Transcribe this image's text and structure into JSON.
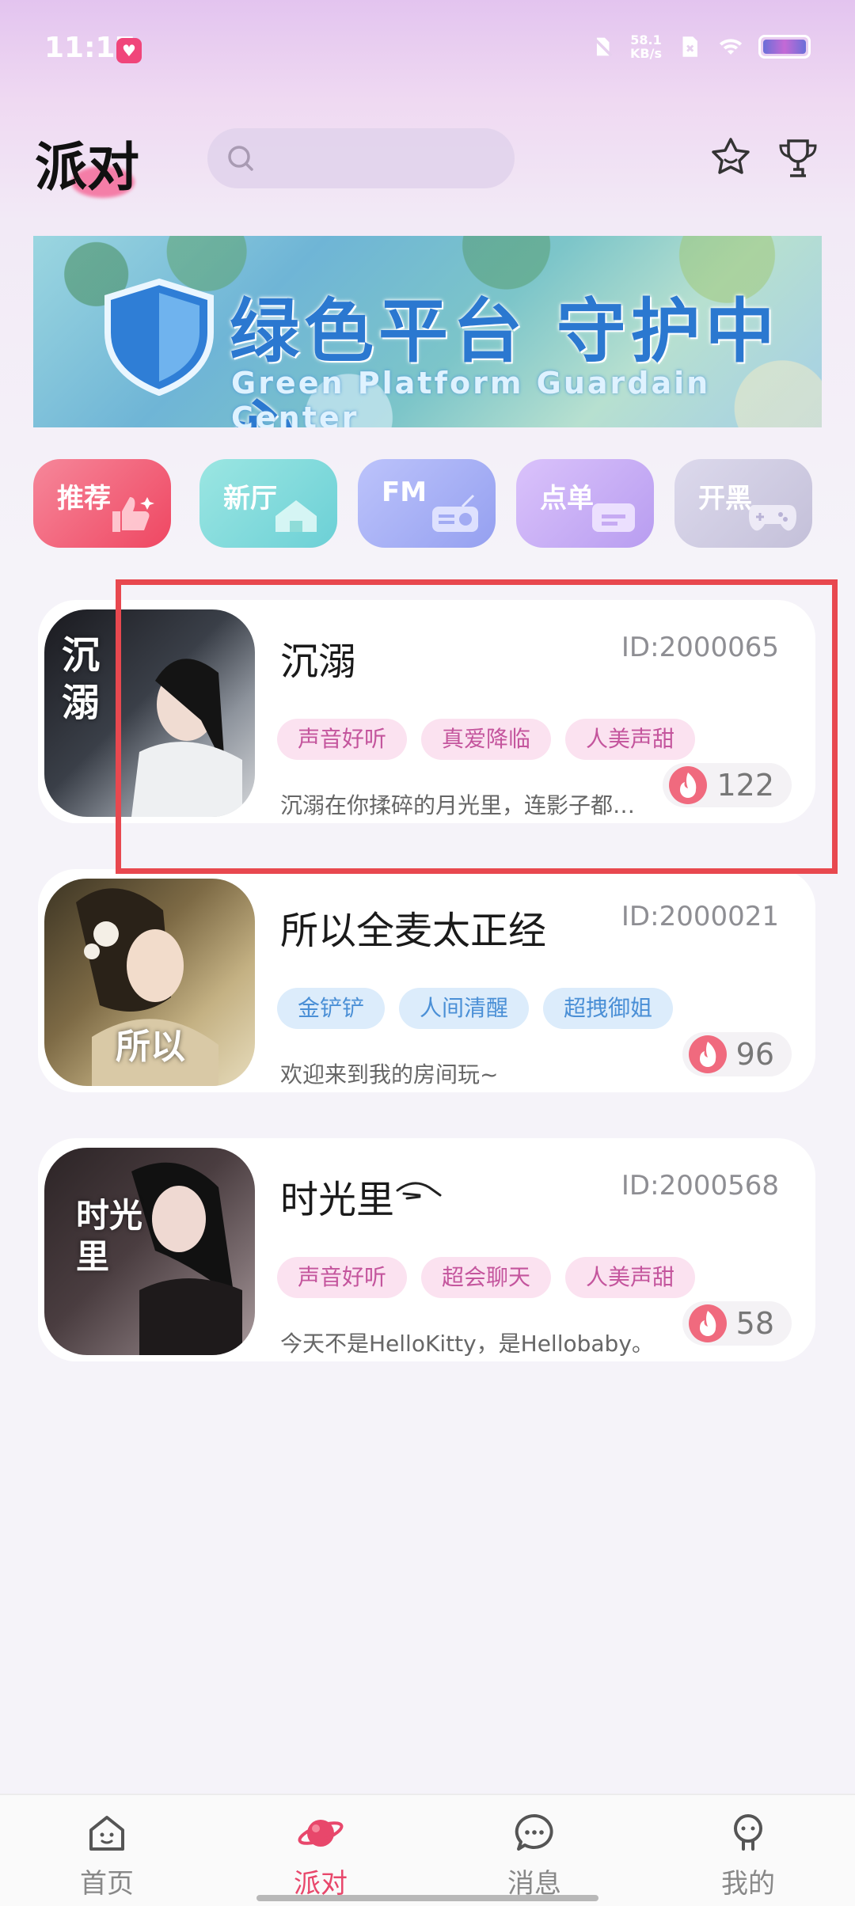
{
  "status_bar": {
    "time": "11:17",
    "network_speed_value": "58.1",
    "network_speed_unit": "KB/s"
  },
  "header": {
    "title": "派对",
    "search_placeholder": "",
    "icons": [
      "star-icon",
      "trophy-icon"
    ]
  },
  "banner": {
    "title": "绿色平台 守护中心",
    "subtitle": "Green Platform Guardain Center"
  },
  "categories": [
    {
      "label": "推荐",
      "icon": "thumbs-up-icon",
      "color": "#f0566e"
    },
    {
      "label": "新厅",
      "icon": "house-icon",
      "color": "#73d2d3"
    },
    {
      "label": "FM",
      "icon": "radio-icon",
      "color": "#9fa8f3"
    },
    {
      "label": "点单",
      "icon": "cart-icon",
      "color": "#c3a2f1"
    },
    {
      "label": "开黑",
      "icon": "gamepad-icon",
      "color": "#c6c2dc"
    }
  ],
  "rooms": [
    {
      "name": "沉溺",
      "id": "ID:2000065",
      "tags": [
        {
          "text": "声音好听",
          "style": "pink"
        },
        {
          "text": "真爱降临",
          "style": "pink"
        },
        {
          "text": "人美声甜",
          "style": "pink"
        }
      ],
      "description": "沉溺在你揉碎的月光里，连影子都…",
      "heat": "122",
      "cover_text": "沉溺"
    },
    {
      "name": "所以全麦太正经",
      "id": "ID:2000021",
      "tags": [
        {
          "text": "金铲铲",
          "style": "blue"
        },
        {
          "text": "人间清醒",
          "style": "blue"
        },
        {
          "text": "超拽御姐",
          "style": "blue"
        }
      ],
      "description": "欢迎来到我的房间玩~",
      "heat": "96",
      "cover_text": "所以"
    },
    {
      "name": "时光里",
      "id": "ID:2000568",
      "tags": [
        {
          "text": "声音好听",
          "style": "pink"
        },
        {
          "text": "超会聊天",
          "style": "pink"
        },
        {
          "text": "人美声甜",
          "style": "pink"
        }
      ],
      "description": "今天不是HelloKitty，是Hellobaby。",
      "heat": "58",
      "cover_text": "时光里"
    }
  ],
  "bottom_nav": [
    {
      "label": "首页",
      "icon": "home-icon",
      "active": false
    },
    {
      "label": "派对",
      "icon": "planet-icon",
      "active": true
    },
    {
      "label": "消息",
      "icon": "message-icon",
      "active": false
    },
    {
      "label": "我的",
      "icon": "profile-icon",
      "active": false
    }
  ],
  "colors": {
    "accent": "#e8476b",
    "highlight_border": "#e8484f"
  }
}
